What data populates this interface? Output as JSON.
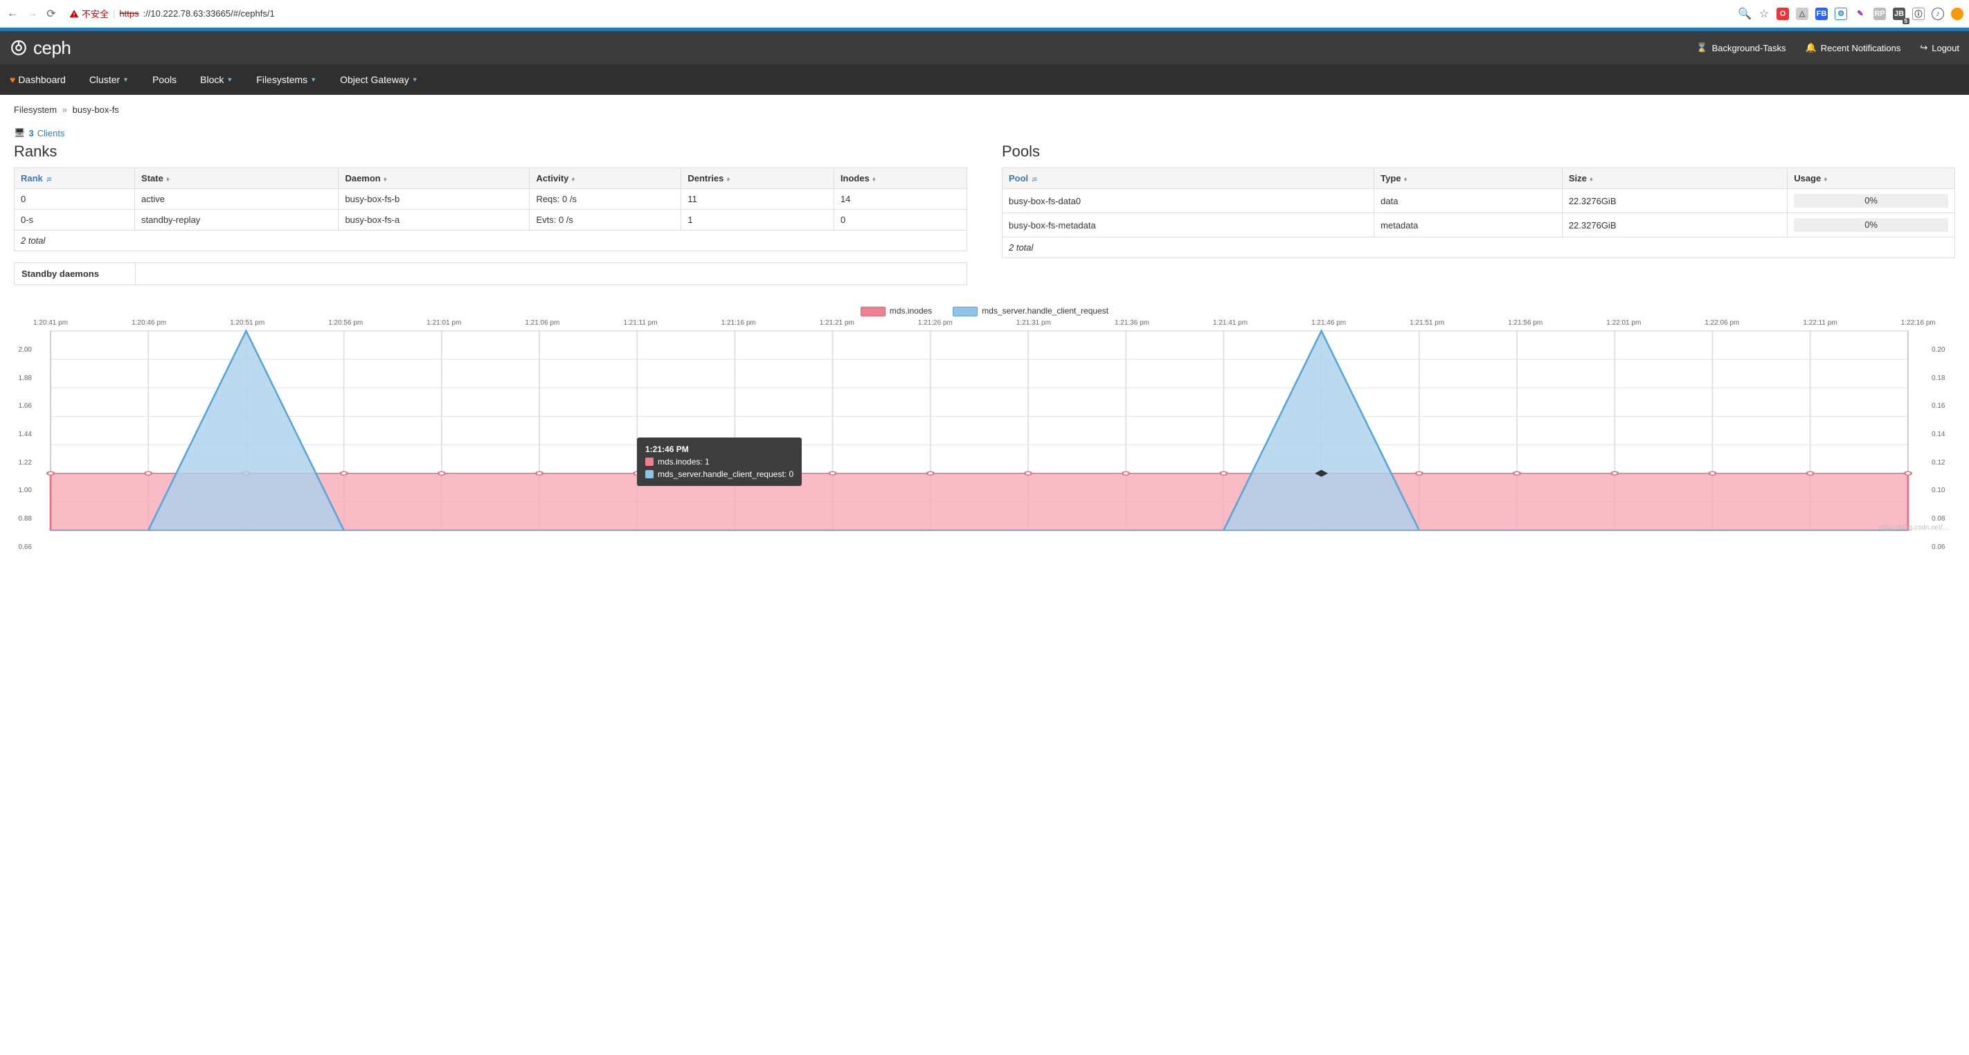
{
  "browser": {
    "insecure_label": "不安全",
    "proto_struck": "https",
    "url_rest": "://10.222.78.63:33665/#/cephfs/1"
  },
  "header": {
    "brand": "ceph",
    "links": {
      "tasks": "Background-Tasks",
      "notifications": "Recent Notifications",
      "logout": "Logout"
    }
  },
  "nav": {
    "dashboard": "Dashboard",
    "cluster": "Cluster",
    "pools": "Pools",
    "block": "Block",
    "filesystems": "Filesystems",
    "object_gateway": "Object Gateway"
  },
  "breadcrumb": {
    "root": "Filesystem",
    "current": "busy-box-fs"
  },
  "clients": {
    "count": "3",
    "label": "Clients"
  },
  "ranks": {
    "title": "Ranks",
    "headers": {
      "rank": "Rank",
      "state": "State",
      "daemon": "Daemon",
      "activity": "Activity",
      "dentries": "Dentries",
      "inodes": "Inodes"
    },
    "rows": [
      {
        "rank": "0",
        "state": "active",
        "daemon": "busy-box-fs-b",
        "activity": "Reqs: 0 /s",
        "dentries": "11",
        "inodes": "14"
      },
      {
        "rank": "0-s",
        "state": "standby-replay",
        "daemon": "busy-box-fs-a",
        "activity": "Evts: 0 /s",
        "dentries": "1",
        "inodes": "0"
      }
    ],
    "footer": "2 total",
    "standby_label": "Standby daemons",
    "standby_value": ""
  },
  "pools": {
    "title": "Pools",
    "headers": {
      "pool": "Pool",
      "type": "Type",
      "size": "Size",
      "usage": "Usage"
    },
    "rows": [
      {
        "pool": "busy-box-fs-data0",
        "type": "data",
        "size": "22.3276GiB",
        "usage": "0%"
      },
      {
        "pool": "busy-box-fs-metadata",
        "type": "metadata",
        "size": "22.3276GiB",
        "usage": "0%"
      }
    ],
    "footer": "2 total"
  },
  "chart_data": {
    "type": "area",
    "x_ticks": [
      "1:20:41 pm",
      "1:20:46 pm",
      "1:20:51 pm",
      "1:20:56 pm",
      "1:21:01 pm",
      "1:21:06 pm",
      "1:21:11 pm",
      "1:21:16 pm",
      "1:21:21 pm",
      "1:21:26 pm",
      "1:21:31 pm",
      "1:21:36 pm",
      "1:21:41 pm",
      "1:21:46 pm",
      "1:21:51 pm",
      "1:21:56 pm",
      "1:22:01 pm",
      "1:22:06 pm",
      "1:22:11 pm",
      "1:22:16 pm"
    ],
    "ylim_left": {
      "min": 0.6,
      "max": 2.0,
      "ticks": [
        "2.00",
        "1.88",
        "1.66",
        "1.44",
        "1.22",
        "1.00",
        "0.88",
        "0.66"
      ]
    },
    "ylim_right": {
      "min": 0.0,
      "max": 0.2,
      "ticks": [
        "0.20",
        "0.18",
        "0.16",
        "0.14",
        "0.12",
        "0.10",
        "0.08",
        "0.06"
      ]
    },
    "series": [
      {
        "name": "mds.inodes",
        "color": "#f08090",
        "axis": "left",
        "values": [
          1.0,
          1.0,
          1.0,
          1.0,
          1.0,
          1.0,
          1.0,
          1.0,
          1.0,
          1.0,
          1.0,
          1.0,
          1.0,
          1.0,
          1.0,
          1.0,
          1.0,
          1.0,
          1.0,
          1.0
        ]
      },
      {
        "name": "mds_server.handle_client_request",
        "color": "#8fc4e8",
        "axis": "right",
        "values": [
          0.0,
          0.0,
          0.2,
          0.0,
          0.0,
          0.0,
          0.0,
          0.0,
          0.0,
          0.0,
          0.0,
          0.0,
          0.0,
          0.2,
          0.0,
          0.0,
          0.0,
          0.0,
          0.0,
          0.0
        ]
      }
    ],
    "tooltip": {
      "time": "1:21:46 PM",
      "rows": [
        {
          "swatch": "#f08090",
          "label": "mds.inodes: 1"
        },
        {
          "swatch": "#8fc4e8",
          "label": "mds_server.handle_client_request: 0"
        }
      ]
    }
  },
  "watermark": "https://blog.csdn.net/..."
}
